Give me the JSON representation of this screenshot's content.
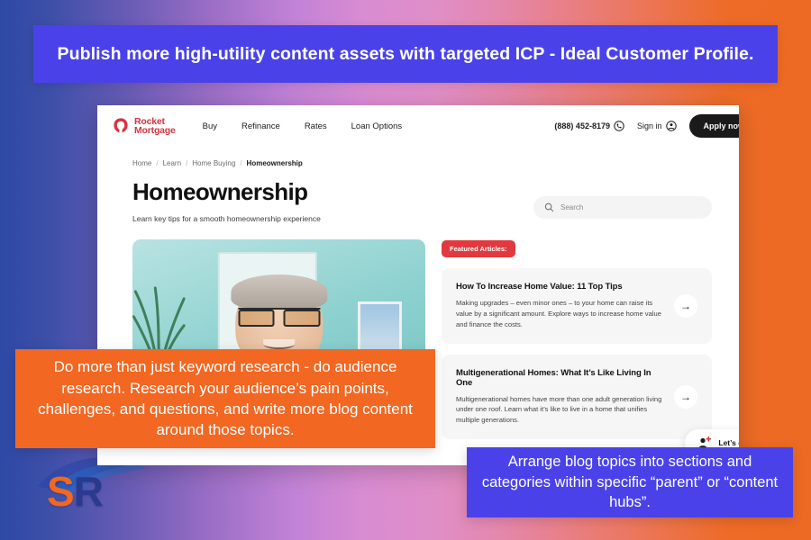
{
  "colors": {
    "banner_blue": "#4a42e8",
    "callout_orange": "#f26722",
    "brand_red": "#d9333f",
    "badge_red": "#e03a3f",
    "logo_s": "#f26722",
    "logo_r": "#2b3a8f",
    "bg_left": "#2e49a6",
    "bg_mid": "#d98cd2",
    "bg_right": "#ec6a23"
  },
  "top_banner": {
    "text": "Publish more high-utility content assets with targeted ICP - Ideal Customer Profile."
  },
  "watermark": {
    "logo_s": "S",
    "logo_r": "R",
    "swoosh_icon": "swoosh-icon"
  },
  "site": {
    "logo": {
      "line1": "Rocket",
      "line2": "Mortgage",
      "mark_icon": "rocket-mortgage-mark-icon"
    },
    "nav": [
      {
        "label": "Buy"
      },
      {
        "label": "Refinance"
      },
      {
        "label": "Rates"
      },
      {
        "label": "Loan Options"
      }
    ],
    "header_right": {
      "phone": "(888) 452-8179",
      "phone_icon": "phone-icon",
      "signin_label": "Sign in",
      "signin_icon": "user-circle-icon",
      "apply_label": "Apply now"
    },
    "breadcrumb": [
      {
        "label": "Home",
        "current": false
      },
      {
        "label": "Learn",
        "current": false
      },
      {
        "label": "Home Buying",
        "current": false
      },
      {
        "label": "Homeownership",
        "current": true
      }
    ],
    "breadcrumb_separator": "/",
    "page_title": "Homeownership",
    "page_subtitle": "Learn key tips for a smooth homeownership experience",
    "search": {
      "placeholder": "Search",
      "icon": "search-icon"
    },
    "hero": {
      "alt": "Smiling older man with glasses in a teal room"
    },
    "featured_badge": "Featured Articles:",
    "articles": [
      {
        "title": "How To Increase Home Value: 11 Top Tips",
        "description": "Making upgrades – even minor ones – to your home can raise its value by a significant amount. Explore ways to increase home value and finance the costs.",
        "arrow_icon": "arrow-right-icon"
      },
      {
        "title": "Multigenerational Homes: What It’s Like Living In One",
        "description": "Multigenerational homes have more than one adult generation living under one roof. Learn what it’s like to live in a home that unifies multiple generations.",
        "arrow_icon": "arrow-right-icon"
      }
    ],
    "chat_widget": {
      "label": "Let’s c",
      "icon": "chat-agent-icon"
    }
  },
  "callouts": {
    "orange": {
      "text": "Do more than just keyword research - do audience research. Research your audience’s pain points, challenges, and questions, and write more blog content around those topics."
    },
    "blue": {
      "text": "Arrange blog topics into sections and categories within specific “parent” or “content hubs”."
    }
  }
}
